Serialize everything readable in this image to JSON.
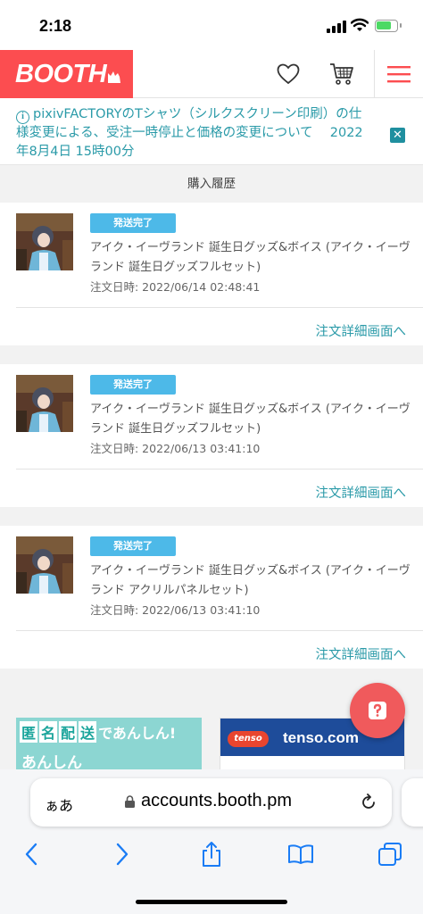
{
  "status": {
    "time": "2:18"
  },
  "header": {
    "logo": "BOOTH",
    "colors": {
      "brand": "#fc4d50"
    }
  },
  "notice": {
    "text": "pixivFACTORYのTシャツ（シルクスクリーン印刷）の仕様変更による、受注一時停止と価格の変更について　 2022年8月4日 15時00分",
    "close_icon": "close-icon"
  },
  "section": {
    "title": "購入履歴"
  },
  "orders": [
    {
      "status": "発送完了",
      "title": "アイク・イーヴランド 誕生日グッズ&ボイス (アイク・イーヴランド 誕生日グッズフルセット)",
      "date": "注文日時: 2022/06/14 02:48:41",
      "link": "注文詳細画面へ"
    },
    {
      "status": "発送完了",
      "title": "アイク・イーヴランド 誕生日グッズ&ボイス (アイク・イーヴランド 誕生日グッズフルセット)",
      "date": "注文日時: 2022/06/13 03:41:10",
      "link": "注文詳細画面へ"
    },
    {
      "status": "発送完了",
      "title": "アイク・イーヴランド 誕生日グッズ&ボイス (アイク・イーヴランド アクリルパネルセット)",
      "date": "注文日時: 2022/06/13 03:41:10",
      "link": "注文詳細画面へ"
    }
  ],
  "ads": {
    "ad1_line1": [
      "匿",
      "名",
      "配",
      "送"
    ],
    "ad1_line1_rest": "であんしん!",
    "ad1_line2": "あんしん",
    "ad2_logo": "tenso",
    "ad2_text": "tenso.com"
  },
  "browser": {
    "aa": "ぁあ",
    "url": "accounts.booth.pm"
  }
}
